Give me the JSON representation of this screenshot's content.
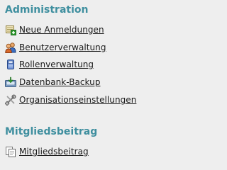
{
  "sections": [
    {
      "title": "Administration",
      "items": [
        {
          "label": "Neue Anmeldungen",
          "icon": "add-user-icon"
        },
        {
          "label": "Benutzerverwaltung",
          "icon": "users-icon"
        },
        {
          "label": "Rollenverwaltung",
          "icon": "role-icon"
        },
        {
          "label": "Datenbank-Backup",
          "icon": "database-backup-icon"
        },
        {
          "label": "Organisationseinstellungen",
          "icon": "tools-icon"
        }
      ]
    },
    {
      "title": "Mitgliedsbeitrag",
      "items": [
        {
          "label": "Mitgliedsbeitrag",
          "icon": "documents-icon"
        }
      ]
    }
  ]
}
